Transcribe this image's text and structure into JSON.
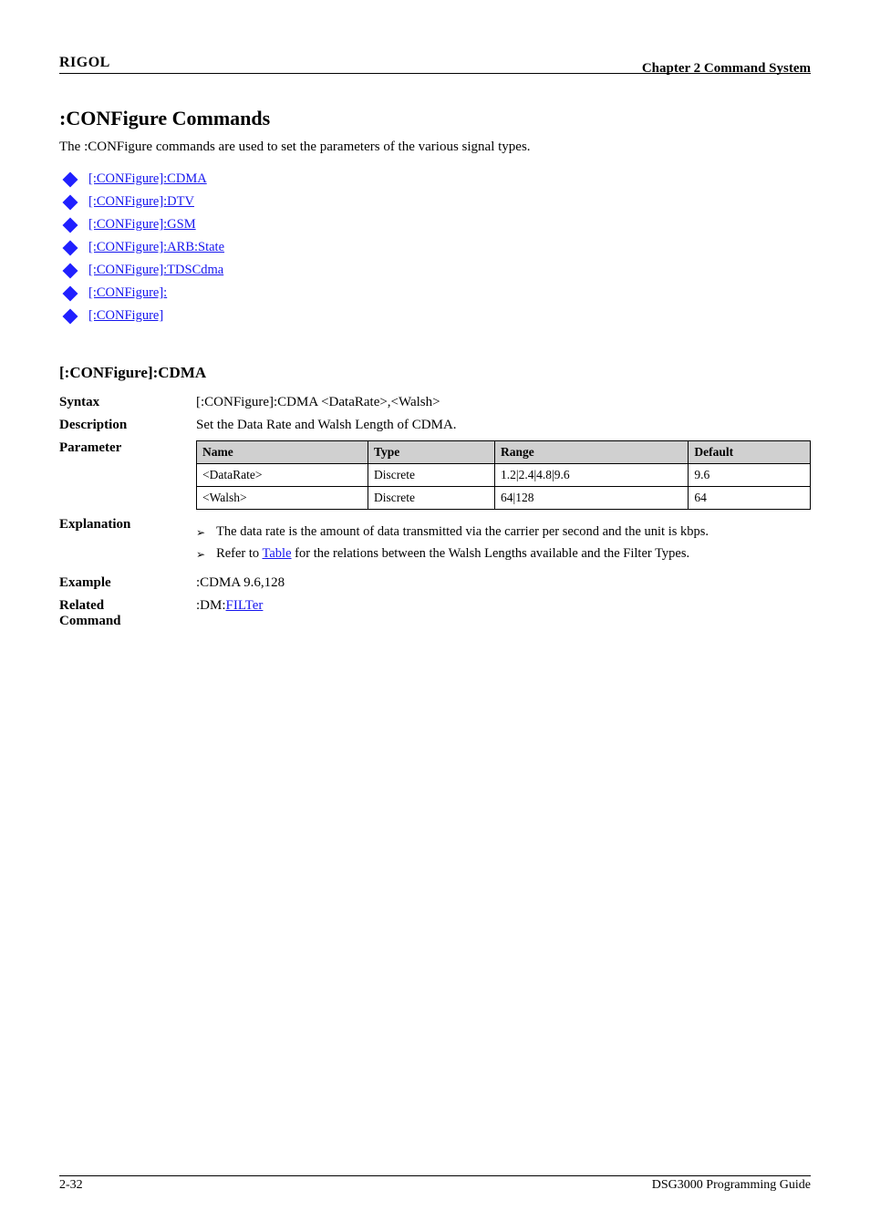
{
  "header": {
    "brand": "RIGOL",
    "chapter": "Chapter 2 Command System"
  },
  "title": ":CONFigure Commands",
  "intro": "The :CONFigure commands are used to set the parameters of the various signal types.",
  "command_links": [
    "[:CONFigure]:CDMA",
    "[:CONFigure]:DTV",
    "[:CONFigure]:GSM",
    "[:CONFigure]:ARB:State",
    "[:CONFigure]:TDSCdma",
    "[:CONFigure]:",
    "[:CONFigure]"
  ],
  "section": {
    "title": "[:CONFigure]:CDMA",
    "syntax_label": "Syntax",
    "syntax": "[:CONFigure]:CDMA <DataRate>,<Walsh>",
    "description_label": "Description",
    "description_text": "Set the Data Rate and Walsh Length of CDMA.",
    "parameter_label": "Parameter",
    "parameter_table": {
      "headers": [
        "Name",
        "Type",
        "Range",
        "Default"
      ],
      "rows": [
        [
          "<DataRate>",
          "Discrete",
          "1.2|2.4|4.8|9.6",
          "9.6"
        ],
        [
          "<Walsh>",
          "Discrete",
          "64|128",
          "64"
        ]
      ]
    },
    "explanation_label": "Explanation",
    "explanations": [
      {
        "plain": "The data rate is the amount of data transmitted via the carrier per second and the unit is kbps."
      },
      {
        "prefix": "Refer to ",
        "link": "Table",
        "suffix": " for the relations between the Walsh Lengths available and the Filter Types."
      }
    ],
    "example_label": "Example",
    "example": ":CDMA 9.6,128",
    "related_label": "Related\nCommand",
    "related_prefix": ":DM:",
    "related_link": "FILTer"
  },
  "footer": {
    "left": "2-32",
    "right": "DSG3000 Programming Guide"
  }
}
